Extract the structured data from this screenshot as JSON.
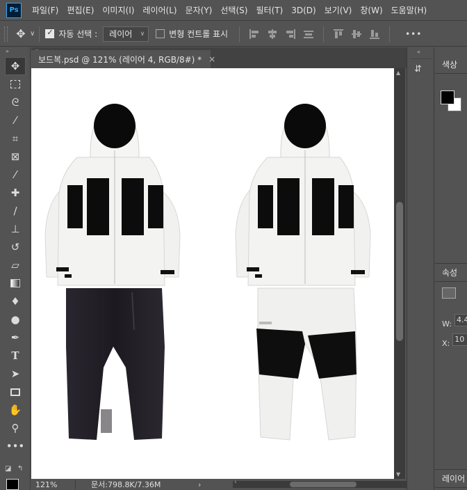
{
  "app": {
    "logo": "Ps"
  },
  "menu": [
    "파일(F)",
    "편집(E)",
    "이미지(I)",
    "레이어(L)",
    "문자(Y)",
    "선택(S)",
    "필터(T)",
    "3D(D)",
    "보기(V)",
    "창(W)",
    "도움말(H)"
  ],
  "options": {
    "auto_select_label": "자동 선택 :",
    "auto_select_checked": true,
    "auto_select_value": "레이어",
    "transform_controls_label": "변형 컨트롤 표시",
    "transform_controls_checked": false,
    "more": "•••"
  },
  "document": {
    "tab_title": "보드복.psd @ 121% (레이어 4, RGB/8#) *",
    "close": "×"
  },
  "status": {
    "zoom": "121%",
    "doc_info": "문서:798.8K/7.36M",
    "arrow": "›"
  },
  "right_panel": {
    "color_tab": "색상",
    "properties_tab": "속성",
    "w_label": "W:",
    "w_value": "4.4",
    "x_label": "X:",
    "x_value": "10",
    "layers_tab": "레이어"
  },
  "tools": [
    "move-icon",
    "marquee-icon",
    "lasso-icon",
    "magic-wand-icon",
    "crop-icon",
    "frame-icon",
    "eyedropper-icon",
    "healing-icon",
    "brush-icon",
    "stamp-icon",
    "history-brush-icon",
    "eraser-icon",
    "gradient-icon",
    "blur-icon",
    "dodge-icon",
    "pen-icon",
    "type-icon",
    "path-select-icon",
    "rectangle-icon",
    "hand-icon",
    "zoom-icon",
    "more-tools-icon"
  ],
  "colors": {
    "foreground": "#000000",
    "background": "#ffffff",
    "ui_bg": "#535353"
  }
}
